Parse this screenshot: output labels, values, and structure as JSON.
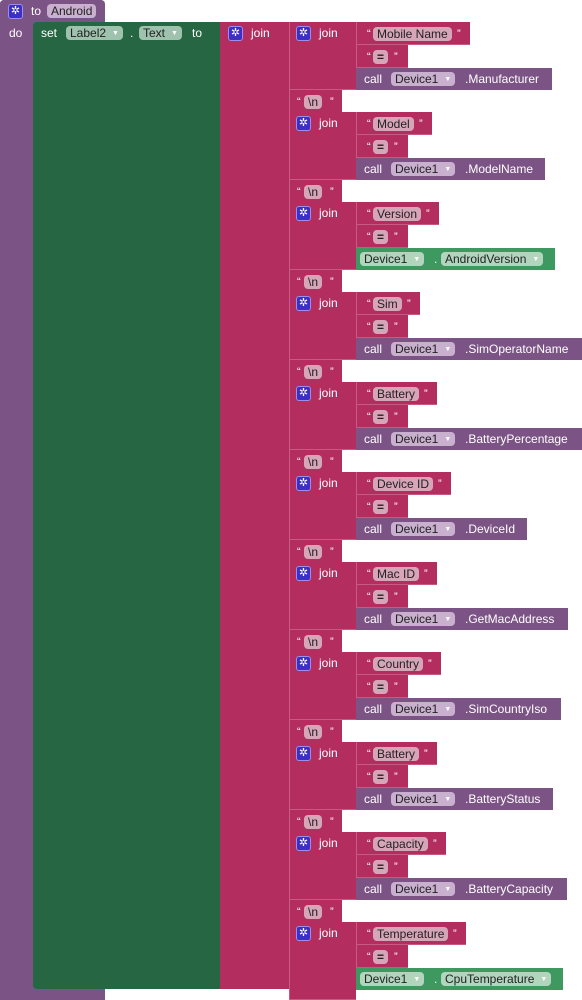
{
  "procedure": {
    "keyword_to": "to",
    "name": "Android",
    "keyword_do": "do"
  },
  "setter": {
    "keyword_set": "set",
    "component": "Label2",
    "dot": ".",
    "property": "Text",
    "keyword_to": "to"
  },
  "outer_join": {
    "label": "join"
  },
  "newline_text": "\\n",
  "equals_text": "=",
  "call_keyword": "call",
  "groups": [
    {
      "label": "Mobile Name",
      "kind": "call",
      "component": "Device1",
      "member": ".Manufacturer"
    },
    {
      "label": "Model",
      "kind": "call",
      "component": "Device1",
      "member": ".ModelName"
    },
    {
      "label": "Version",
      "kind": "property",
      "component": "Device1",
      "member": "AndroidVersion"
    },
    {
      "label": "Sim",
      "kind": "call",
      "component": "Device1",
      "member": ".SimOperatorName"
    },
    {
      "label": "Battery",
      "kind": "call",
      "component": "Device1",
      "member": ".BatteryPercentage"
    },
    {
      "label": "Device ID",
      "kind": "call",
      "component": "Device1",
      "member": ".DeviceId"
    },
    {
      "label": "Mac ID",
      "kind": "call",
      "component": "Device1",
      "member": ".GetMacAddress"
    },
    {
      "label": "Country",
      "kind": "call",
      "component": "Device1",
      "member": ".SimCountryIso"
    },
    {
      "label": "Battery",
      "kind": "call",
      "component": "Device1",
      "member": ".BatteryStatus"
    },
    {
      "label": "Capacity",
      "kind": "call",
      "component": "Device1",
      "member": ".BatteryCapacity"
    },
    {
      "label": "Temperature",
      "kind": "property",
      "component": "Device1",
      "member": "CpuTemperature"
    }
  ],
  "icons": {
    "gear": "mutator-gear-icon",
    "dropdown": "dropdown-arrow-icon"
  }
}
